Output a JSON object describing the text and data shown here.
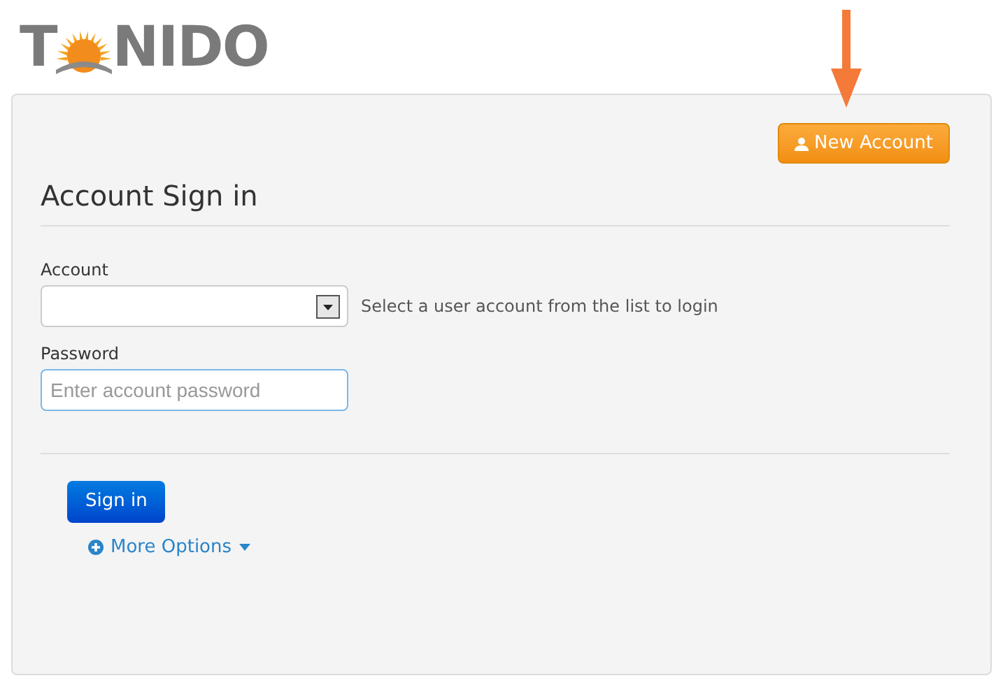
{
  "logo": {
    "text_before": "T",
    "text_after": "NIDO"
  },
  "new_account_button": {
    "label": "New Account"
  },
  "heading": "Account Sign in",
  "account": {
    "label": "Account",
    "hint": "Select a user account from the list to login"
  },
  "password": {
    "label": "Password",
    "placeholder": "Enter account password"
  },
  "sign_in_button": {
    "label": "Sign in"
  },
  "more_options": {
    "label": "More Options"
  }
}
